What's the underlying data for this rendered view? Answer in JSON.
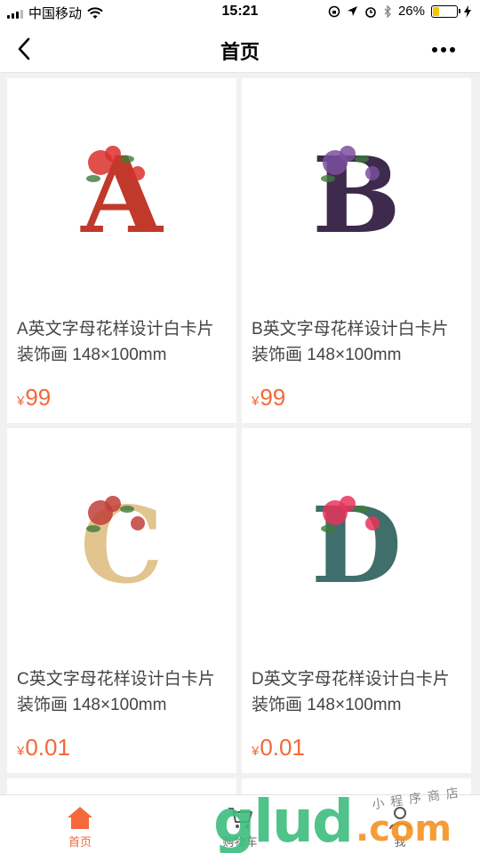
{
  "status_bar": {
    "carrier": "中国移动",
    "time": "15:21",
    "battery_percent": "26%",
    "battery_level": 0.26
  },
  "nav": {
    "title": "首页"
  },
  "products": [
    {
      "letter": "A",
      "title": "A英文字母花样设计白卡片 装饰画 148×100mm",
      "currency": "¥",
      "price": "99",
      "letter_color": "#c0392b",
      "flower_color": "#d9302b"
    },
    {
      "letter": "B",
      "title": "B英文字母花样设计白卡片 装饰画 148×100mm",
      "currency": "¥",
      "price": "99",
      "letter_color": "#3e2a4d",
      "flower_color": "#7a4f9c"
    },
    {
      "letter": "C",
      "title": "C英文字母花样设计白卡片 装饰画 148×100mm",
      "currency": "¥",
      "price": "0.01",
      "letter_color": "#e2c48f",
      "flower_color": "#c0403a"
    },
    {
      "letter": "D",
      "title": "D英文字母花样设计白卡片 装饰画 148×100mm",
      "currency": "¥",
      "price": "0.01",
      "letter_color": "#3f6e6b",
      "flower_color": "#e8345a"
    }
  ],
  "tabs": [
    {
      "label": "首页",
      "icon": "home-icon",
      "active": true
    },
    {
      "label": "购物车",
      "icon": "cart-icon",
      "active": false
    },
    {
      "label": "我",
      "icon": "user-icon",
      "active": false
    }
  ],
  "watermark": {
    "brand": "glud",
    "domain": ".com",
    "tagline": "小程序商店"
  },
  "colors": {
    "accent": "#f4683a",
    "background": "#f1f1f1"
  }
}
